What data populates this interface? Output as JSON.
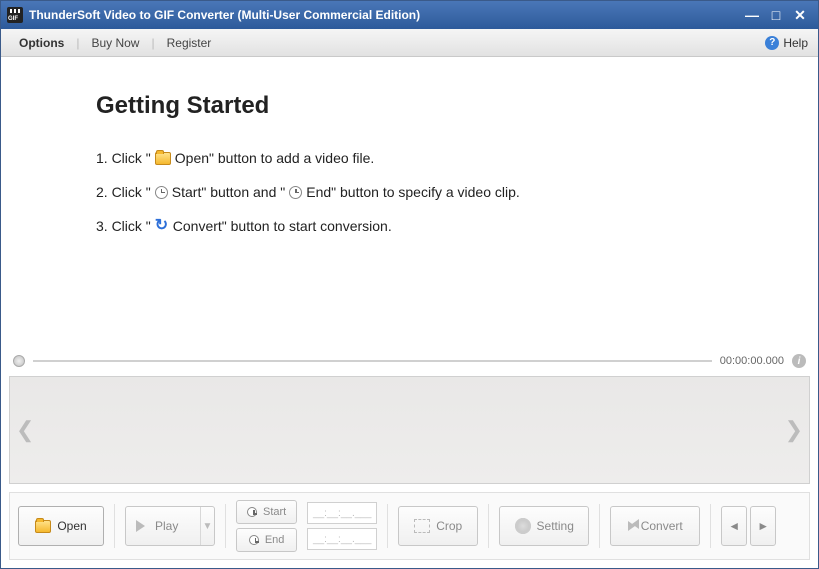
{
  "title": "ThunderSoft Video to GIF Converter (Multi-User Commercial Edition)",
  "menu": {
    "options": "Options",
    "buy": "Buy Now",
    "register": "Register",
    "help": "Help"
  },
  "content": {
    "heading": "Getting Started",
    "step1_a": "1. Click \"",
    "step1_b": " Open\" button to add a video file.",
    "step2_a": "2. Click \"",
    "step2_b": " Start\" button and \"",
    "step2_c": " End\" button to specify a video clip.",
    "step3_a": "3. Click \"",
    "step3_b": " Convert\" button to start conversion."
  },
  "time": "00:00:00.000",
  "toolbar": {
    "open": "Open",
    "play": "Play",
    "start": "Start",
    "end": "End",
    "crop": "Crop",
    "setting": "Setting",
    "convert": "Convert",
    "tfield": "__:__:__.___"
  }
}
